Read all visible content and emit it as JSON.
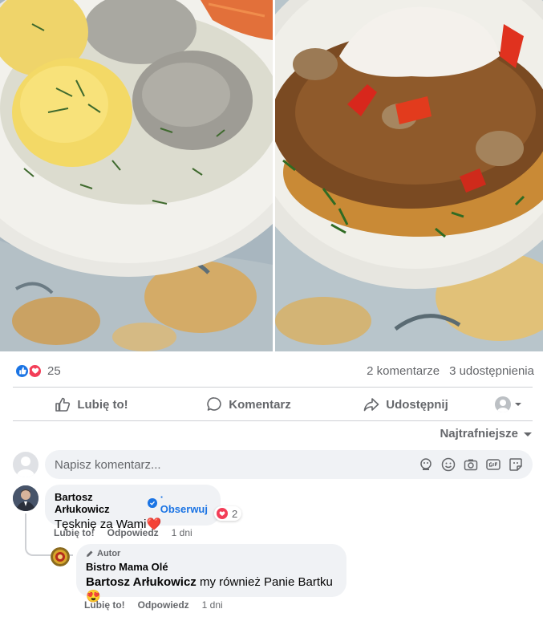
{
  "post": {
    "reactions_count": "25",
    "comments_count": "2 komentarze",
    "shares_count": "3 udostępnienia"
  },
  "actions": {
    "like": "Lubię to!",
    "comment": "Komentarz",
    "share": "Udostępnij"
  },
  "sort": {
    "label": "Najtrafniejsze"
  },
  "composer": {
    "placeholder": "Napisz komentarz..."
  },
  "comments": [
    {
      "author": "Bartosz Arłukowicz",
      "follow": "· Obserwuj",
      "text": "Tęsknię za Wami",
      "text_emoji": "❤️",
      "reaction_count": "2",
      "like": "Lubię to!",
      "reply": "Odpowiedz",
      "time": "1 dni"
    }
  ],
  "reply": {
    "author_tag": "Autor",
    "author": "Bistro Mama Olé",
    "mention": "Bartosz Arłukowicz",
    "text": " my również Panie Bartku ",
    "text_emoji": "😍",
    "like": "Lubię to!",
    "reply": "Odpowiedz",
    "time": "1 dni"
  },
  "colors": {
    "accent": "#1b74e4",
    "love": "#f33e58",
    "secondary_text": "#65676b",
    "bubble": "#f0f2f5"
  }
}
